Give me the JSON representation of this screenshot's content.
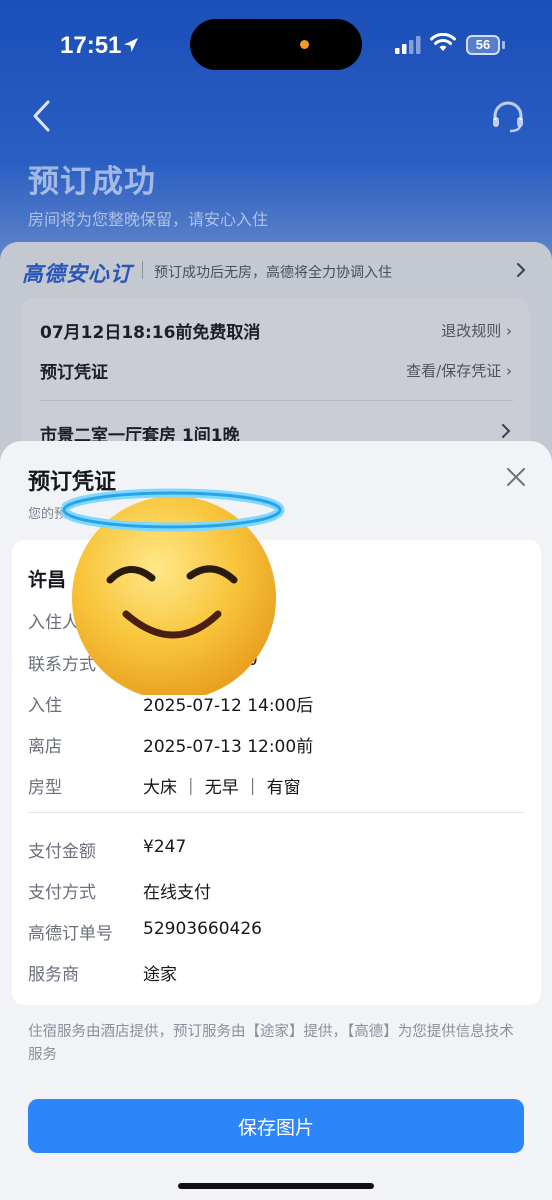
{
  "status_bar": {
    "time": "17:51",
    "battery": "56",
    "icons": [
      "location-arrow-icon",
      "signal-icon",
      "wifi-icon",
      "battery-icon"
    ]
  },
  "header": {
    "back_icon": "chevron-left-icon",
    "support_icon": "headset-icon",
    "title": "预订成功",
    "subtitle": "房间将为您整晚保留，请安心入住"
  },
  "assurance": {
    "brand": "高德安心订",
    "description": "预订成功后无房，高德将全力协调入住"
  },
  "order": {
    "cancel_deadline": "07月12日18:16前免费取消",
    "rules_link": "退改规则",
    "voucher_label": "预订凭证",
    "voucher_link": "查看/保存凭证",
    "room_summary": "市景二室一厅套房 1间1晚"
  },
  "sheet": {
    "title": "预订凭证",
    "subtitle": "您的预",
    "hotel_name": "许昌",
    "rows_top": [
      {
        "label": "入住人",
        "value": ""
      },
      {
        "label": "联系方式",
        "value": "00"
      },
      {
        "label": "入住",
        "value": "2025-07-12 14:00后"
      },
      {
        "label": "离店",
        "value": "2025-07-13 12:00前"
      },
      {
        "label": "房型",
        "value": "大床 ｜ 无早 ｜ 有窗"
      }
    ],
    "rows_bottom": [
      {
        "label": "支付金额",
        "value": "¥247"
      },
      {
        "label": "支付方式",
        "value": "在线支付"
      },
      {
        "label": "高德订单号",
        "value": "52903660426"
      },
      {
        "label": "服务商",
        "value": "途家"
      }
    ],
    "footnote": "住宿服务由酒店提供，预订服务由【途家】提供，【高德】为您提供信息技术服务",
    "save_button": "保存图片"
  },
  "colors": {
    "header_blue": "#1b4fb9",
    "brand_blue": "#2a55b8",
    "primary_button": "#2c86fa",
    "island_dot": "#f59a22"
  },
  "overlay": {
    "icon": "smiling-face-with-halo-emoji"
  }
}
